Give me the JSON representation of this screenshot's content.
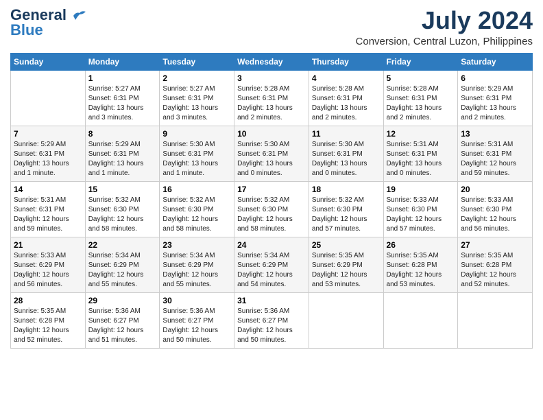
{
  "logo": {
    "line1": "General",
    "line2": "Blue",
    "bird_unicode": "🐦"
  },
  "title": {
    "month_year": "July 2024",
    "location": "Conversion, Central Luzon, Philippines"
  },
  "header_row": [
    "Sunday",
    "Monday",
    "Tuesday",
    "Wednesday",
    "Thursday",
    "Friday",
    "Saturday"
  ],
  "weeks": [
    [
      {
        "day": "",
        "info": ""
      },
      {
        "day": "1",
        "info": "Sunrise: 5:27 AM\nSunset: 6:31 PM\nDaylight: 13 hours\nand 3 minutes."
      },
      {
        "day": "2",
        "info": "Sunrise: 5:27 AM\nSunset: 6:31 PM\nDaylight: 13 hours\nand 3 minutes."
      },
      {
        "day": "3",
        "info": "Sunrise: 5:28 AM\nSunset: 6:31 PM\nDaylight: 13 hours\nand 2 minutes."
      },
      {
        "day": "4",
        "info": "Sunrise: 5:28 AM\nSunset: 6:31 PM\nDaylight: 13 hours\nand 2 minutes."
      },
      {
        "day": "5",
        "info": "Sunrise: 5:28 AM\nSunset: 6:31 PM\nDaylight: 13 hours\nand 2 minutes."
      },
      {
        "day": "6",
        "info": "Sunrise: 5:29 AM\nSunset: 6:31 PM\nDaylight: 13 hours\nand 2 minutes."
      }
    ],
    [
      {
        "day": "7",
        "info": "Sunrise: 5:29 AM\nSunset: 6:31 PM\nDaylight: 13 hours\nand 1 minute."
      },
      {
        "day": "8",
        "info": "Sunrise: 5:29 AM\nSunset: 6:31 PM\nDaylight: 13 hours\nand 1 minute."
      },
      {
        "day": "9",
        "info": "Sunrise: 5:30 AM\nSunset: 6:31 PM\nDaylight: 13 hours\nand 1 minute."
      },
      {
        "day": "10",
        "info": "Sunrise: 5:30 AM\nSunset: 6:31 PM\nDaylight: 13 hours\nand 0 minutes."
      },
      {
        "day": "11",
        "info": "Sunrise: 5:30 AM\nSunset: 6:31 PM\nDaylight: 13 hours\nand 0 minutes."
      },
      {
        "day": "12",
        "info": "Sunrise: 5:31 AM\nSunset: 6:31 PM\nDaylight: 13 hours\nand 0 minutes."
      },
      {
        "day": "13",
        "info": "Sunrise: 5:31 AM\nSunset: 6:31 PM\nDaylight: 12 hours\nand 59 minutes."
      }
    ],
    [
      {
        "day": "14",
        "info": "Sunrise: 5:31 AM\nSunset: 6:31 PM\nDaylight: 12 hours\nand 59 minutes."
      },
      {
        "day": "15",
        "info": "Sunrise: 5:32 AM\nSunset: 6:30 PM\nDaylight: 12 hours\nand 58 minutes."
      },
      {
        "day": "16",
        "info": "Sunrise: 5:32 AM\nSunset: 6:30 PM\nDaylight: 12 hours\nand 58 minutes."
      },
      {
        "day": "17",
        "info": "Sunrise: 5:32 AM\nSunset: 6:30 PM\nDaylight: 12 hours\nand 58 minutes."
      },
      {
        "day": "18",
        "info": "Sunrise: 5:32 AM\nSunset: 6:30 PM\nDaylight: 12 hours\nand 57 minutes."
      },
      {
        "day": "19",
        "info": "Sunrise: 5:33 AM\nSunset: 6:30 PM\nDaylight: 12 hours\nand 57 minutes."
      },
      {
        "day": "20",
        "info": "Sunrise: 5:33 AM\nSunset: 6:30 PM\nDaylight: 12 hours\nand 56 minutes."
      }
    ],
    [
      {
        "day": "21",
        "info": "Sunrise: 5:33 AM\nSunset: 6:29 PM\nDaylight: 12 hours\nand 56 minutes."
      },
      {
        "day": "22",
        "info": "Sunrise: 5:34 AM\nSunset: 6:29 PM\nDaylight: 12 hours\nand 55 minutes."
      },
      {
        "day": "23",
        "info": "Sunrise: 5:34 AM\nSunset: 6:29 PM\nDaylight: 12 hours\nand 55 minutes."
      },
      {
        "day": "24",
        "info": "Sunrise: 5:34 AM\nSunset: 6:29 PM\nDaylight: 12 hours\nand 54 minutes."
      },
      {
        "day": "25",
        "info": "Sunrise: 5:35 AM\nSunset: 6:29 PM\nDaylight: 12 hours\nand 53 minutes."
      },
      {
        "day": "26",
        "info": "Sunrise: 5:35 AM\nSunset: 6:28 PM\nDaylight: 12 hours\nand 53 minutes."
      },
      {
        "day": "27",
        "info": "Sunrise: 5:35 AM\nSunset: 6:28 PM\nDaylight: 12 hours\nand 52 minutes."
      }
    ],
    [
      {
        "day": "28",
        "info": "Sunrise: 5:35 AM\nSunset: 6:28 PM\nDaylight: 12 hours\nand 52 minutes."
      },
      {
        "day": "29",
        "info": "Sunrise: 5:36 AM\nSunset: 6:27 PM\nDaylight: 12 hours\nand 51 minutes."
      },
      {
        "day": "30",
        "info": "Sunrise: 5:36 AM\nSunset: 6:27 PM\nDaylight: 12 hours\nand 50 minutes."
      },
      {
        "day": "31",
        "info": "Sunrise: 5:36 AM\nSunset: 6:27 PM\nDaylight: 12 hours\nand 50 minutes."
      },
      {
        "day": "",
        "info": ""
      },
      {
        "day": "",
        "info": ""
      },
      {
        "day": "",
        "info": ""
      }
    ]
  ]
}
